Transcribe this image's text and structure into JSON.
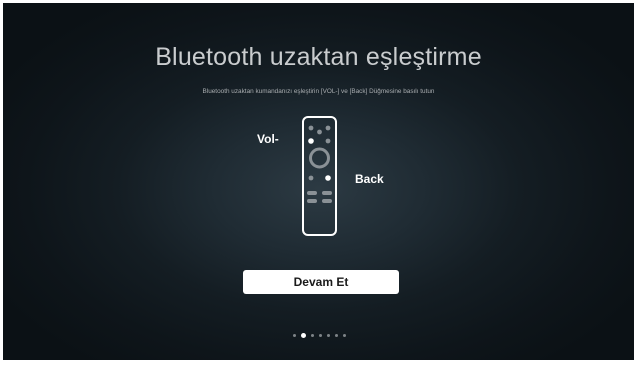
{
  "screen": {
    "title": "Bluetooth uzaktan eşleştirme",
    "subtitle": "Bluetooth uzaktan kumandanızı eşleştirin [VOL-] ve [Back] Düğmesine basılı tutun"
  },
  "remote": {
    "vol_label": "Vol-",
    "back_label": "Back",
    "icon": "remote-control-icon"
  },
  "actions": {
    "continue_label": "Devam Et"
  },
  "pager": {
    "total_pages": 7,
    "current_page": 2
  },
  "colors": {
    "background": "#0e151a",
    "title": "#c9ccce",
    "button_bg": "#ffffff",
    "dot_active": "#ffffff",
    "dot_inactive": "#7d8387"
  }
}
